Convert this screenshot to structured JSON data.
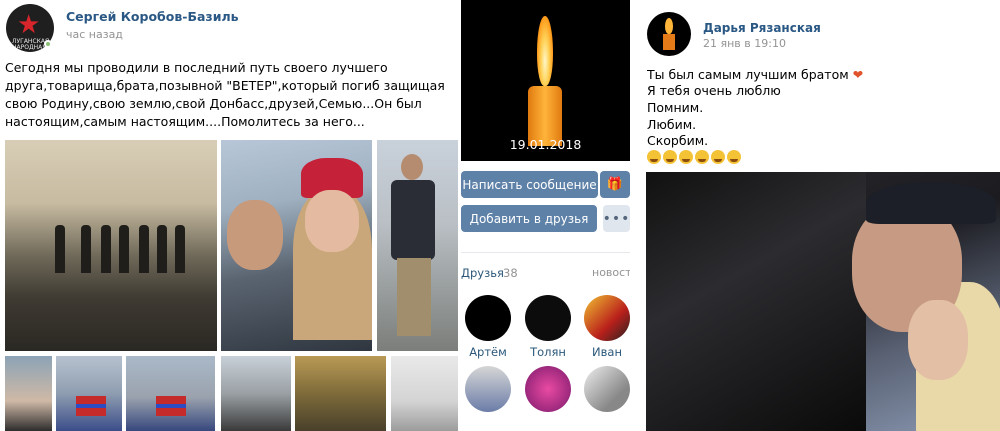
{
  "left_post": {
    "author": "Сергей Коробов-Базиль",
    "time": "час назад",
    "avatar_text": "ЛУГАНСКАЯ НАРОДНАЯ",
    "text": "Сегодня мы проводили в последний путь своего лучшего друга,товарища,брата,позывной \"ВЕТЕР\",который погиб защищая свою Родину,свою землю,свой Донбасс,друзей,Семью...Он был настоящим,самым настоящим....Помолитесь за него..."
  },
  "profile": {
    "cover_date": "19.01.2018",
    "message_button": "Написать сообщение",
    "add_friend_button": "Добавить в друзья",
    "more_button": "•••",
    "friends_label": "Друзья",
    "friends_count": "38",
    "news_label": "новост",
    "friends": [
      {
        "name": "Артём"
      },
      {
        "name": "Толян"
      },
      {
        "name": "Иван"
      },
      {
        "name": ""
      },
      {
        "name": ""
      },
      {
        "name": ""
      }
    ]
  },
  "right_post": {
    "author": "Дарья Рязанская",
    "time": "21 янв в 19:10",
    "lines": [
      "Ты был самым лучшим братом",
      "Я тебя очень люблю",
      "Помним.",
      "Любим.",
      "Скорбим."
    ],
    "emoji_count": 6
  },
  "icons": {
    "gift": "gift-icon",
    "heart": "heart-icon",
    "star": "star-icon"
  },
  "colors": {
    "link": "#2a5885",
    "button": "#5e81a8",
    "muted": "#939393"
  }
}
